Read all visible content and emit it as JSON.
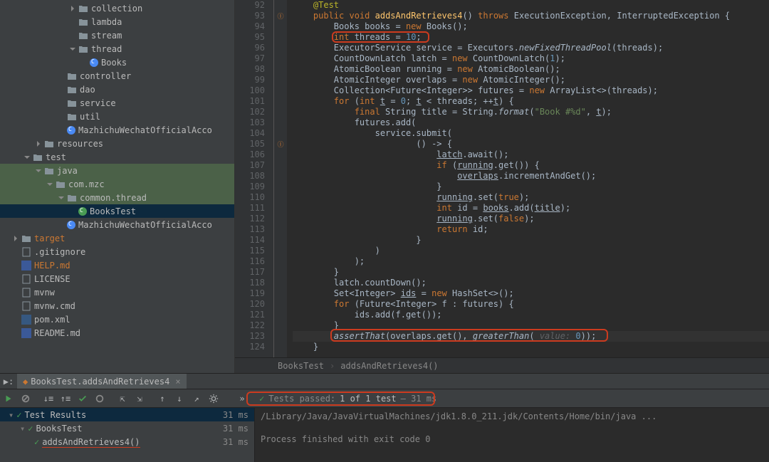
{
  "sidebar": {
    "items": [
      {
        "indent": 6,
        "twisty": "right",
        "icon": "folder",
        "label": "collection"
      },
      {
        "indent": 6,
        "twisty": "none",
        "icon": "folder",
        "label": "lambda"
      },
      {
        "indent": 6,
        "twisty": "none",
        "icon": "folder",
        "label": "stream"
      },
      {
        "indent": 6,
        "twisty": "down",
        "icon": "folder",
        "label": "thread"
      },
      {
        "indent": 7,
        "twisty": "none",
        "icon": "class",
        "label": "Books"
      },
      {
        "indent": 5,
        "twisty": "none",
        "icon": "folder",
        "label": "controller"
      },
      {
        "indent": 5,
        "twisty": "none",
        "icon": "folder",
        "label": "dao"
      },
      {
        "indent": 5,
        "twisty": "none",
        "icon": "folder",
        "label": "service"
      },
      {
        "indent": 5,
        "twisty": "none",
        "icon": "folder",
        "label": "util"
      },
      {
        "indent": 5,
        "twisty": "none",
        "icon": "class",
        "label": "MazhichuWechatOfficialAcco"
      },
      {
        "indent": 3,
        "twisty": "right",
        "icon": "folder",
        "label": "resources"
      },
      {
        "indent": 2,
        "twisty": "down",
        "icon": "folder",
        "label": "test"
      },
      {
        "indent": 3,
        "twisty": "down",
        "icon": "folder",
        "label": "java",
        "highlighted": true
      },
      {
        "indent": 4,
        "twisty": "down",
        "icon": "folder",
        "label": "com.mzc",
        "highlighted": true
      },
      {
        "indent": 5,
        "twisty": "down",
        "icon": "folder",
        "label": "common.thread",
        "highlighted": true
      },
      {
        "indent": 6,
        "twisty": "none",
        "icon": "test-class",
        "label": "BooksTest",
        "selected": true
      },
      {
        "indent": 5,
        "twisty": "none",
        "icon": "class",
        "label": "MazhichuWechatOfficialAcco"
      },
      {
        "indent": 1,
        "twisty": "right",
        "icon": "folder",
        "label": "target",
        "target": true
      },
      {
        "indent": 1,
        "twisty": "none",
        "icon": "file",
        "label": ".gitignore"
      },
      {
        "indent": 1,
        "twisty": "none",
        "icon": "md",
        "label": "HELP.md",
        "help": true
      },
      {
        "indent": 1,
        "twisty": "none",
        "icon": "file",
        "label": "LICENSE"
      },
      {
        "indent": 1,
        "twisty": "none",
        "icon": "file",
        "label": "mvnw"
      },
      {
        "indent": 1,
        "twisty": "none",
        "icon": "file",
        "label": "mvnw.cmd"
      },
      {
        "indent": 1,
        "twisty": "none",
        "icon": "xml",
        "label": "pom.xml"
      },
      {
        "indent": 1,
        "twisty": "none",
        "icon": "md",
        "label": "README.md"
      }
    ]
  },
  "editor": {
    "lines": [
      {
        "n": 92,
        "html": "    <span class='annotation'>@Test</span>"
      },
      {
        "n": 93,
        "html": "    <span class='kw'>public void</span> <span style='color:#ffc66d'>addsAndRetrieves4</span>() <span class='kw'>throws</span> ExecutionException, InterruptedException {",
        "icon": "impl"
      },
      {
        "n": 94,
        "html": "        Books books = <span class='kw'>new</span> Books();"
      },
      {
        "n": 95,
        "html": "        <span class='kw'>int</span> threads = <span class='num'>10</span>;"
      },
      {
        "n": 96,
        "html": "        ExecutorService service = Executors.<span class='method-static'>newFixedThreadPool</span>(threads);"
      },
      {
        "n": 97,
        "html": "        CountDownLatch latch = <span class='kw'>new</span> CountDownLatch(<span class='num'>1</span>);"
      },
      {
        "n": 98,
        "html": "        AtomicBoolean running = <span class='kw'>new</span> AtomicBoolean();"
      },
      {
        "n": 99,
        "html": "        AtomicInteger overlaps = <span class='kw'>new</span> AtomicInteger();"
      },
      {
        "n": 100,
        "html": "        Collection&lt;Future&lt;Integer&gt;&gt; futures = <span class='kw'>new</span> ArrayList&lt;&gt;(threads);"
      },
      {
        "n": 101,
        "html": "        <span class='kw'>for</span> (<span class='kw'>int</span> <span class='underlined'>t</span> = <span class='num'>0</span>; <span class='underlined'>t</span> &lt; threads; ++<span class='underlined'>t</span>) {"
      },
      {
        "n": 102,
        "html": "            <span class='kw'>final</span> String title = String.<span class='method-static'>format</span>(<span class='str'>\"Book #%d\"</span>, <span class='underlined'>t</span>);"
      },
      {
        "n": 103,
        "html": "            futures.add("
      },
      {
        "n": 104,
        "html": "                service.submit("
      },
      {
        "n": 105,
        "html": "                        () -&gt; {",
        "icon": "impl"
      },
      {
        "n": 106,
        "html": "                            <span class='underlined'>latch</span>.await();"
      },
      {
        "n": 107,
        "html": "                            <span class='kw'>if</span> (<span class='underlined'>running</span>.get()) {"
      },
      {
        "n": 108,
        "html": "                                <span class='underlined'>overlaps</span>.incrementAndGet();"
      },
      {
        "n": 109,
        "html": "                            }"
      },
      {
        "n": 110,
        "html": "                            <span class='underlined'>running</span>.set(<span class='kw'>true</span>);"
      },
      {
        "n": 111,
        "html": "                            <span class='kw'>int</span> id = <span class='underlined'>books</span>.add(<span class='underlined'>title</span>);"
      },
      {
        "n": 112,
        "html": "                            <span class='underlined'>running</span>.set(<span class='kw'>false</span>);"
      },
      {
        "n": 113,
        "html": "                            <span class='kw'>return</span> id;"
      },
      {
        "n": 114,
        "html": "                        }"
      },
      {
        "n": 115,
        "html": "                )"
      },
      {
        "n": 116,
        "html": "            );"
      },
      {
        "n": 117,
        "html": "        }"
      },
      {
        "n": 118,
        "html": "        latch.countDown();"
      },
      {
        "n": 119,
        "html": "        Set&lt;Integer&gt; <span class='underlined'>ids</span> = <span class='kw'>new</span> HashSet&lt;&gt;();"
      },
      {
        "n": 120,
        "html": "        <span class='kw'>for</span> (Future&lt;Integer&gt; f : futures) {"
      },
      {
        "n": 121,
        "html": "            ids.add(f.get());"
      },
      {
        "n": 122,
        "html": "        }"
      },
      {
        "n": 123,
        "html": "        <span class='method-static'>assertThat</span>(overlaps.get(), <span class='method-static'>greaterThan</span>( <span class='param-hint'>value:</span> <span class='num'>0</span>));",
        "cursor": true
      },
      {
        "n": 124,
        "html": "    }"
      }
    ],
    "breadcrumbs": [
      "BooksTest",
      "addsAndRetrieves4()"
    ]
  },
  "run": {
    "tabLabel": "BooksTest.addsAndRetrieves4",
    "statusPrefix": "Tests passed:",
    "statusCount": "1 of 1 test",
    "statusTime": "– 31 ms",
    "tree": [
      {
        "indent": 0,
        "label": "Test Results",
        "time": "31 ms",
        "selected": true
      },
      {
        "indent": 1,
        "label": "BooksTest",
        "time": "31 ms"
      },
      {
        "indent": 2,
        "label": "addsAndRetrieves4()",
        "time": "31 ms",
        "underline": true
      }
    ],
    "console": [
      "/Library/Java/JavaVirtualMachines/jdk1.8.0_211.jdk/Contents/Home/bin/java ...",
      "",
      "Process finished with exit code 0"
    ]
  }
}
